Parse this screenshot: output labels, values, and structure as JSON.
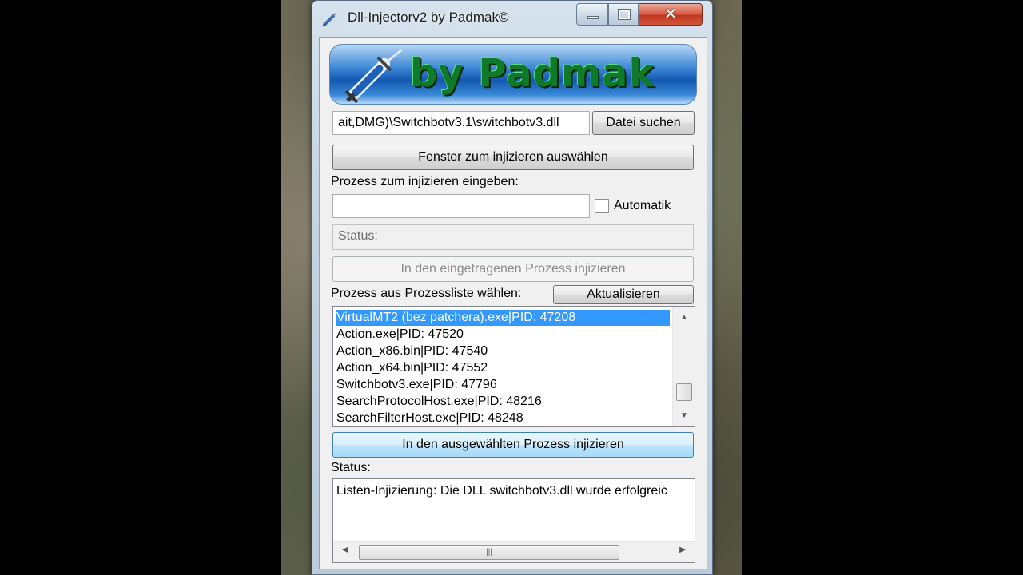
{
  "window": {
    "title": "Dll-Injectorv2 by Padmak©",
    "banner_text": "by Padmak"
  },
  "dll": {
    "path": "ait,DMG)\\Switchbotv3.1\\switchbotv3.dll",
    "browse_label": "Datei suchen"
  },
  "select_window_label": "Fenster zum injizieren auswählen",
  "manual": {
    "label": "Prozess zum injizieren eingeben:",
    "input_value": "",
    "automatic_label": "Automatik",
    "automatic_checked": false,
    "status_placeholder": "Status:",
    "inject_label": "In den eingetragenen Prozess injizieren"
  },
  "process_list": {
    "label": "Prozess aus Prozessliste wählen:",
    "refresh_label": "Aktualisieren",
    "items": [
      "VirtualMT2 (bez patchera).exe|PID: 47208",
      "Action.exe|PID: 47520",
      "Action_x86.bin|PID: 47540",
      "Action_x64.bin|PID: 47552",
      "Switchbotv3.exe|PID: 47796",
      "SearchProtocolHost.exe|PID: 48216",
      "SearchFilterHost.exe|PID: 48248"
    ],
    "selected_index": 0,
    "inject_label": "In den ausgewählten Prozess injizieren"
  },
  "status": {
    "label": "Status:",
    "text": "Listen-Injizierung: Die DLL switchbotv3.dll wurde erfolgreic"
  },
  "icons": {
    "title": "syringe-icon",
    "banner": "syringe-icon"
  }
}
